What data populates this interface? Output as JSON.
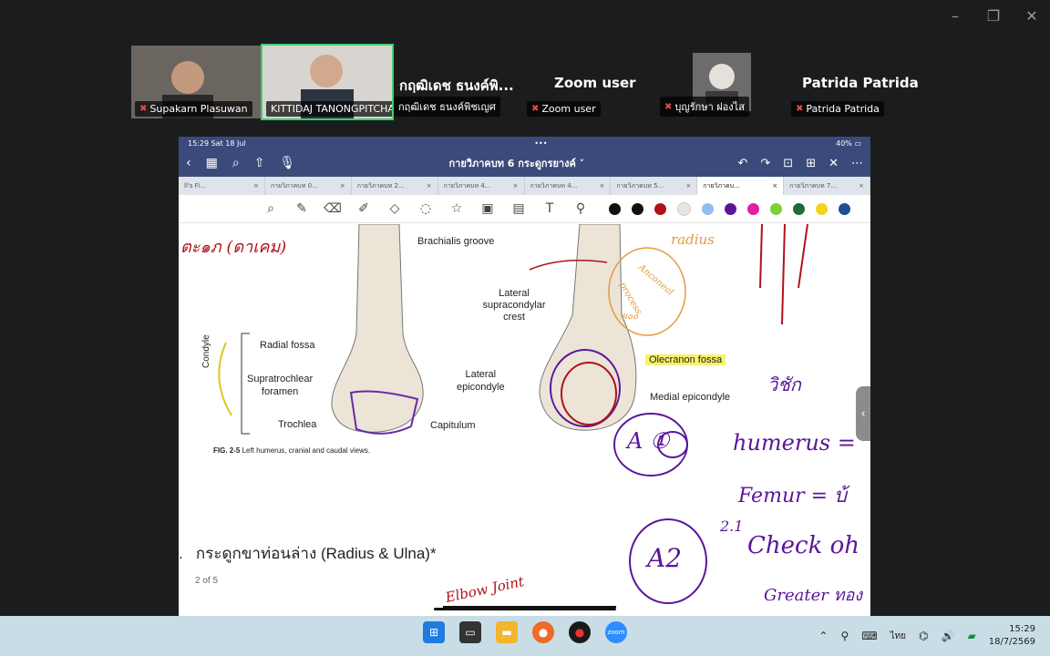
{
  "window_controls": [
    "–",
    "❐",
    "✕"
  ],
  "participants": [
    {
      "label": "Supakarn Plasuwan"
    },
    {
      "label": "KITTIDAJ TANONGPITCHA..."
    },
    {
      "big_name": "กฤฒิเดช ธนงค์พิ...",
      "label": "กฤฒิเดช ธนงค์พิชเญศ"
    },
    {
      "big_name": "Zoom user",
      "label": "Zoom user"
    },
    {
      "label": "บุญรักษา ฝองไส"
    },
    {
      "big_name": "Patrida Patrida",
      "label": "Patrida Patrida"
    }
  ],
  "ipad": {
    "status_time": "15:29  Sat 18 Jul",
    "status_dots": "•••",
    "status_right": "40%",
    "doc_title": "กายวิภาคบท 6 กระดูกรยางค์ ˅",
    "tabs": [
      "ll's Fi...",
      "กายวิภาคบท 0...",
      "กายวิภาคบท 2...",
      "กายวิภาคบท 4...",
      "กายวิภาคบท 4...",
      "กายวิภาคบท 5...",
      "กายวิภาคบ...",
      "กายวิภาคบท 7..."
    ],
    "active_tab_index": 6,
    "colors": [
      "#111111",
      "#111111",
      "#b0121b",
      "#e5e5e5",
      "#8fbfef",
      "#5a169a",
      "#e11fa2",
      "#7dcf3c",
      "#1f6b3b",
      "#f4d31a",
      "#1e4c96"
    ]
  },
  "page": {
    "brachialis": "Brachialis groove",
    "lateral_supra": [
      "Lateral",
      "supracondylar",
      "crest"
    ],
    "radial_fossa": "Radial fossa",
    "supratrochlear": [
      "Supratrochlear",
      "foramen"
    ],
    "trochlea": "Trochlea",
    "capitulum": "Capitulum",
    "lateral_epi": [
      "Lateral",
      "epicondyle"
    ],
    "olecranon": "Olecranon fossa",
    "medial_epi": "Medial epicondyle",
    "condyle": "Condyle",
    "fig_caption_bold": "FIG. 2-5",
    "fig_caption": "Left humerus, cranial and caudal views.",
    "section_heading": "กระดูกขาท่อนล่าง (Radius & Ulna)*",
    "section_bullet": ".",
    "page_num": "2 of 5",
    "hand_top_left": "ตะ๑ภ (ดาเคม)",
    "hand_radius": "radius",
    "hand_anconeal": "Anconeal",
    "hand_process": "process",
    "hand_pd": "ผ๐๐",
    "hand_a1": "A ①",
    "hand_humerus": "humerus =",
    "hand_femur": "Femur  = บ้",
    "hand_a2": "A2",
    "hand_21": "2.1",
    "hand_check": "Check oh",
    "hand_greater": "Greater ทอง",
    "hand_elbow": "Elbow Joint",
    "hand_thai": "วิชัก"
  },
  "taskbar": {
    "zoom_label": "zoom",
    "lang": "ไทย",
    "time": "15:29",
    "date": "18/7/2569"
  }
}
